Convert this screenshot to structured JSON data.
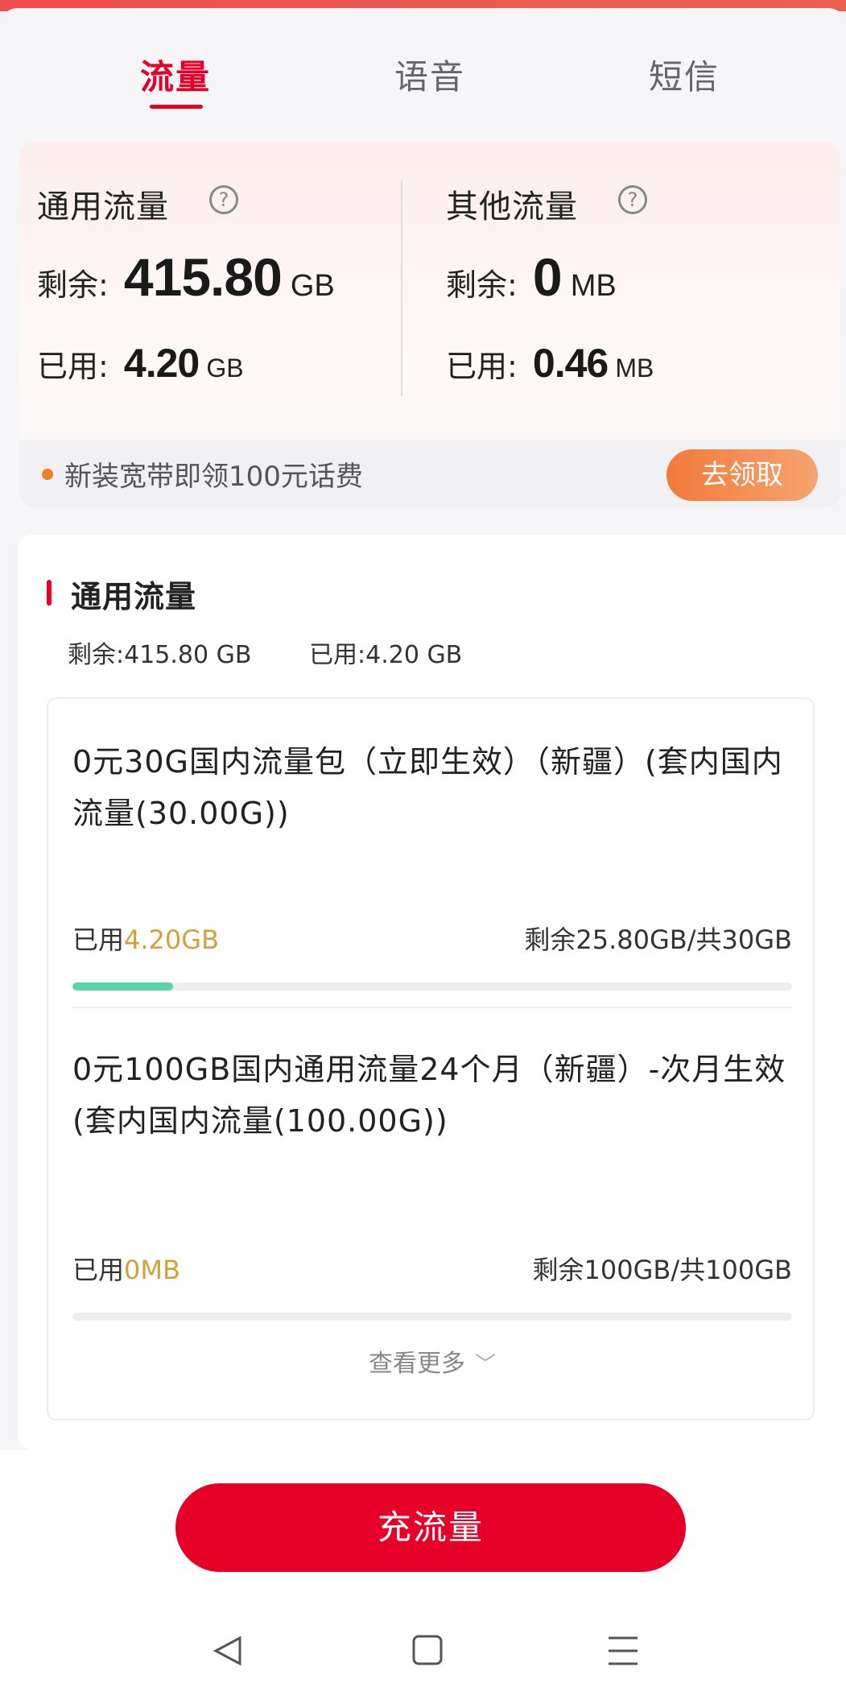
{
  "tabs": [
    {
      "label": "流量",
      "active": true
    },
    {
      "label": "语音",
      "active": false
    },
    {
      "label": "短信",
      "active": false
    }
  ],
  "summary": {
    "general": {
      "title": "通用流量",
      "help_icon": "question-circle-icon",
      "remain_label": "剩余:",
      "remain_value": "415.80",
      "remain_unit": "GB",
      "used_label": "已用:",
      "used_value": "4.20",
      "used_unit": "GB"
    },
    "other": {
      "title": "其他流量",
      "help_icon": "question-circle-icon",
      "remain_label": "剩余:",
      "remain_value": "0",
      "remain_unit": "MB",
      "used_label": "已用:",
      "used_value": "0.46",
      "used_unit": "MB"
    },
    "promo": {
      "text": "新装宽带即领100元话费",
      "button": "去领取"
    }
  },
  "detail": {
    "title": "通用流量",
    "remain_text": "剩余:415.80 GB",
    "used_text": "已用:4.20 GB",
    "packages": [
      {
        "name": "0元30G国内流量包（立即生效）（新疆）(套内国内流量(30.00G))",
        "used_label": "已用",
        "used_value": "4.20GB",
        "remain_text": "剩余25.80GB/共30GB",
        "progress": 0.14
      },
      {
        "name": "0元100GB国内通用流量24个月（新疆）-次月生效 (套内国内流量(100.00G))",
        "used_label": "已用",
        "used_value": "0MB",
        "remain_text": "剩余100GB/共100GB",
        "progress": 0
      }
    ],
    "more_label": "查看更多"
  },
  "recharge_button": "充流量",
  "colors": {
    "brand_red": "#e60027",
    "progress_green": "#5cd3a8",
    "used_gold": "#d4a03a",
    "promo_orange": "#f27a3a"
  }
}
